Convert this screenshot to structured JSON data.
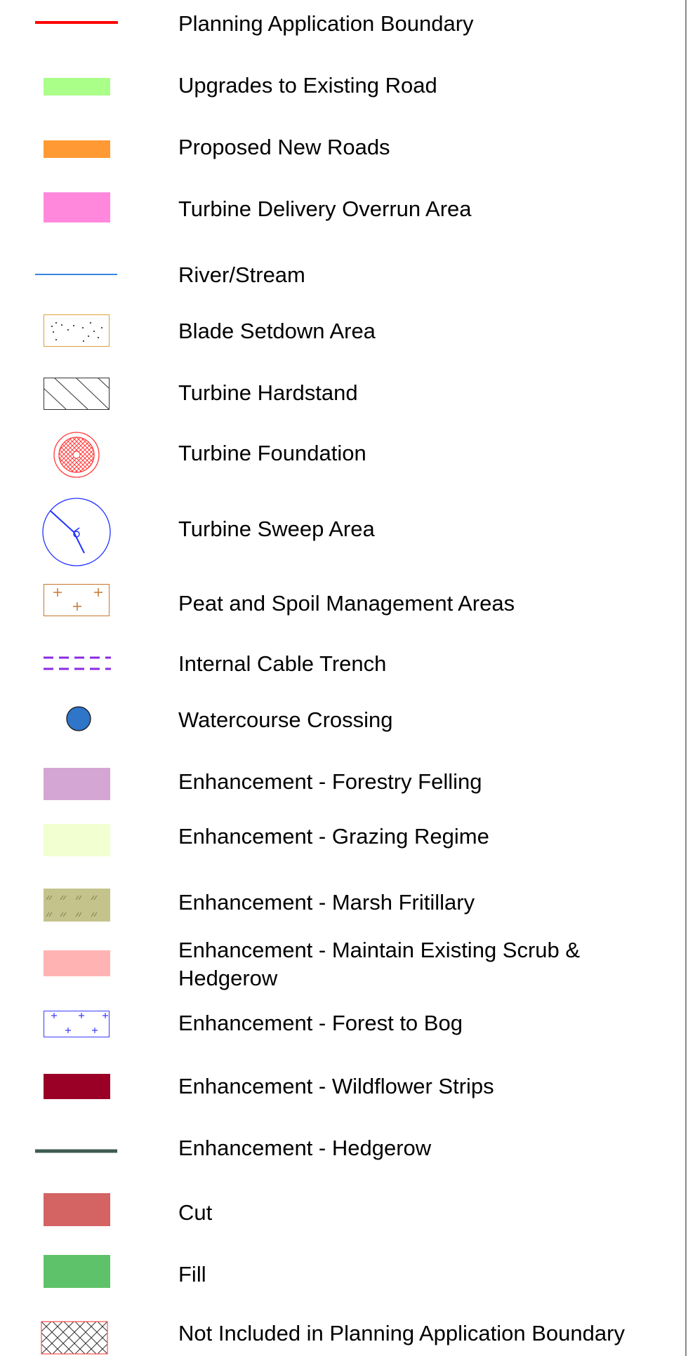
{
  "legend": {
    "items": [
      {
        "key": "planning-boundary",
        "label": "Planning Application Boundary",
        "color": "#ff0000"
      },
      {
        "key": "upgrades-road",
        "label": "Upgrades to Existing Road",
        "color": "#aaff88"
      },
      {
        "key": "new-roads",
        "label": "Proposed New Roads",
        "color": "#ff9933"
      },
      {
        "key": "overrun-area",
        "label": "Turbine Delivery Overrun Area",
        "color": "#ff88dd"
      },
      {
        "key": "river-stream",
        "label": "River/Stream",
        "color": "#3388dd"
      },
      {
        "key": "blade-setdown",
        "label": "Blade Setdown Area",
        "color": "#d8a13a"
      },
      {
        "key": "turbine-hardstand",
        "label": "Turbine Hardstand",
        "color": "#333333"
      },
      {
        "key": "turbine-foundation",
        "label": "Turbine Foundation",
        "color": "#ff2b2b"
      },
      {
        "key": "turbine-sweep",
        "label": "Turbine Sweep Area",
        "color": "#2233ff"
      },
      {
        "key": "peat-spoil",
        "label": "Peat and Spoil Management Areas",
        "color": "#c8762d"
      },
      {
        "key": "cable-trench",
        "label": "Internal Cable Trench",
        "color": "#8a2be2"
      },
      {
        "key": "watercourse-crossing",
        "label": "Watercourse Crossing",
        "color": "#2f75c8"
      },
      {
        "key": "forestry-felling",
        "label": "Enhancement - Forestry Felling",
        "color": "#d3a6d3"
      },
      {
        "key": "grazing-regime",
        "label": "Enhancement - Grazing Regime",
        "color": "#f1ffd1"
      },
      {
        "key": "marsh-fritillary",
        "label": "Enhancement - Marsh Fritillary",
        "color": "#c4c38c"
      },
      {
        "key": "scrub-hedgerow",
        "label": "Enhancement - Maintain Existing Scrub & Hedgerow",
        "color": "#ffb3b3"
      },
      {
        "key": "forest-to-bog",
        "label": "Enhancement - Forest to Bog",
        "color": "#3a3aff"
      },
      {
        "key": "wildflower-strips",
        "label": "Enhancement - Wildflower Strips",
        "color": "#9a0026"
      },
      {
        "key": "hedgerow",
        "label": "Enhancement - Hedgerow",
        "color": "#3e5b50"
      },
      {
        "key": "cut",
        "label": "Cut",
        "color": "#d46363"
      },
      {
        "key": "fill",
        "label": "Fill",
        "color": "#5ec26a"
      },
      {
        "key": "not-included",
        "label": "Not Included in Planning Application Boundary",
        "color": "#ff4b4b"
      }
    ]
  }
}
